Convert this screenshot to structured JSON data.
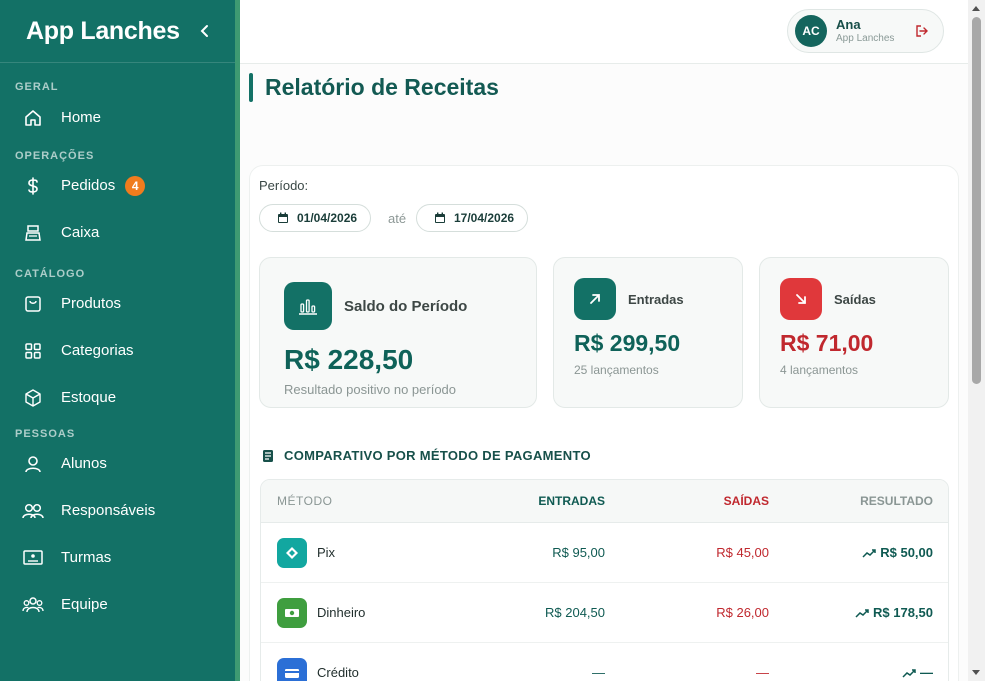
{
  "app": {
    "title": "App Lanches"
  },
  "sidebar": {
    "sections": [
      {
        "label": "GERAL"
      },
      {
        "label": "OPERAÇÕES"
      },
      {
        "label": "CATÁLOGO"
      },
      {
        "label": "PESSOAS"
      }
    ],
    "items": [
      {
        "label": "Home",
        "icon": "home-icon"
      },
      {
        "label": "Pedidos",
        "icon": "dollar-icon",
        "badge": "4"
      },
      {
        "label": "Caixa",
        "icon": "cash-register-icon"
      },
      {
        "label": "Produtos",
        "icon": "product-icon"
      },
      {
        "label": "Categorias",
        "icon": "grid-icon"
      },
      {
        "label": "Estoque",
        "icon": "box-icon"
      },
      {
        "label": "Alunos",
        "icon": "user-icon"
      },
      {
        "label": "Responsáveis",
        "icon": "users-icon"
      },
      {
        "label": "Turmas",
        "icon": "class-board-icon"
      },
      {
        "label": "Equipe",
        "icon": "team-icon"
      }
    ]
  },
  "user": {
    "initials": "AC",
    "name": "Ana",
    "subtitle": "App Lanches"
  },
  "page": {
    "title": "Relatório de Receitas"
  },
  "period": {
    "label": "Período:",
    "start": "01/04/2026",
    "separator": "até",
    "end": "17/04/2026"
  },
  "cards": {
    "saldo": {
      "label": "Saldo do Período",
      "value": "R$ 228,50",
      "sub": "Resultado positivo no período",
      "color": "#0f6259"
    },
    "entradas": {
      "label": "Entradas",
      "value": "R$ 299,50",
      "sub": "25 lançamentos",
      "color": "#0f6259"
    },
    "saidas": {
      "label": "Saídas",
      "value": "R$ 71,00",
      "sub": "4 lançamentos",
      "color": "#c0282e"
    }
  },
  "comparison": {
    "title": "COMPARATIVO POR MÉTODO DE PAGAMENTO",
    "headers": {
      "method": "MÉTODO",
      "in": "ENTRADAS",
      "out": "SAÍDAS",
      "result": "RESULTADO"
    },
    "rows": [
      {
        "method": "Pix",
        "in": "R$ 95,00",
        "out": "R$ 45,00",
        "result": "R$ 50,00",
        "icon": "pix-icon"
      },
      {
        "method": "Dinheiro",
        "in": "R$ 204,50",
        "out": "R$ 26,00",
        "result": "R$ 178,50",
        "icon": "cash-icon"
      },
      {
        "method": "Crédito",
        "in": "—",
        "out": "—",
        "result": "—",
        "icon": "credit-card-icon"
      }
    ]
  },
  "colors": {
    "primary": "#137166",
    "positive": "#0f6259",
    "negative": "#c0282e",
    "badge": "#f07c1e"
  }
}
